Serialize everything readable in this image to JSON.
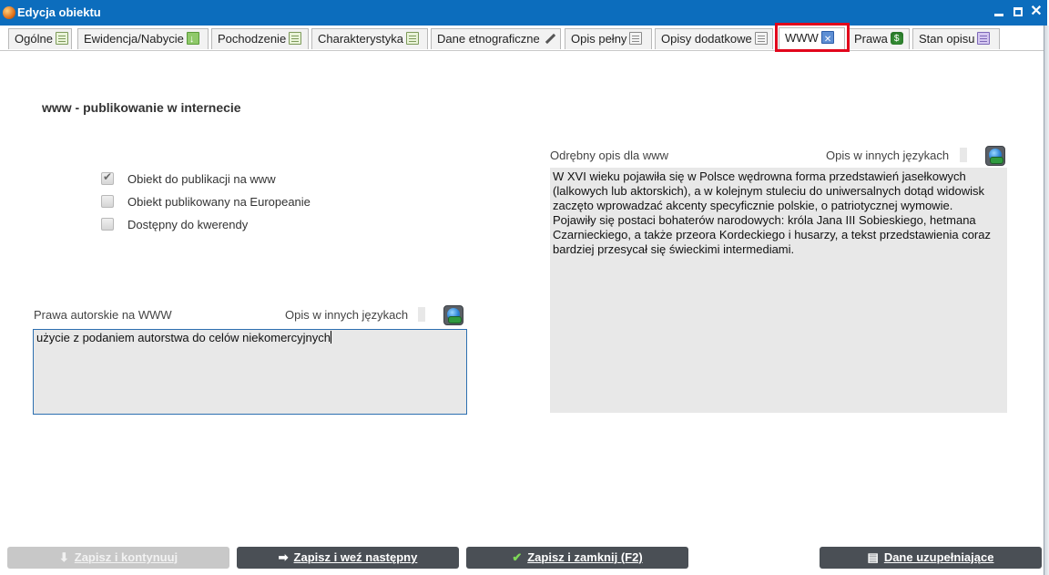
{
  "window": {
    "title": "Edycja obiektu"
  },
  "tabs": [
    {
      "label": "Ogólne",
      "icon": "list-icon"
    },
    {
      "label": "Ewidencja/Nabycie",
      "icon": "download-icon"
    },
    {
      "label": "Pochodzenie",
      "icon": "list-icon"
    },
    {
      "label": "Charakterystyka",
      "icon": "list-icon"
    },
    {
      "label": "Dane etnograficzne",
      "icon": "pen-icon"
    },
    {
      "label": "Opis pełny",
      "icon": "document-icon"
    },
    {
      "label": "Opisy dodatkowe",
      "icon": "document-icon"
    },
    {
      "label": "WWW",
      "icon": "www-icon",
      "active": true
    },
    {
      "label": "Prawa",
      "icon": "money-icon"
    },
    {
      "label": "Stan opisu",
      "icon": "status-icon"
    }
  ],
  "section": {
    "title": "www - publikowanie w internecie"
  },
  "checkboxes": [
    {
      "label": "Obiekt do publikacji na www",
      "checked": true
    },
    {
      "label": "Obiekt publikowany na Europeanie",
      "checked": false
    },
    {
      "label": "Dostępny do kwerendy",
      "checked": false
    }
  ],
  "rights": {
    "label": "Prawa autorskie na WWW",
    "other_languages_label": "Opis w innych językach",
    "value": "użycie z podaniem autorstwa do celów niekomercyjnych"
  },
  "www_description": {
    "label": "Odrębny opis dla www",
    "other_languages_label": "Opis w innych językach",
    "value": "W XVI wieku pojawiła się w Polsce wędrowna forma przedstawień jasełkowych\n(lalkowych lub aktorskich), a w kolejnym stuleciu do uniwersalnych dotąd widowisk\nzaczęto wprowadzać akcenty specyficznie polskie, o patriotycznej wymowie.\nPojawiły się postaci bohaterów narodowych: króla Jana III Sobieskiego, hetmana\nCzarnieckiego, a także przeora Kordeckiego i husarzy, a tekst przedstawienia coraz\nbardziej przesycał się świeckimi intermediami."
  },
  "footer": {
    "save_continue": "Zapisz i kontynuuj",
    "save_next": "Zapisz i weź następny",
    "save_close": "Zapisz i zamknij (F2)",
    "extra_data": "Dane uzupełniające"
  },
  "colors": {
    "titlebar": "#0c6dbd",
    "highlight": "#e2061c",
    "button": "#4a4f55",
    "button_disabled": "#c8c8c8"
  }
}
